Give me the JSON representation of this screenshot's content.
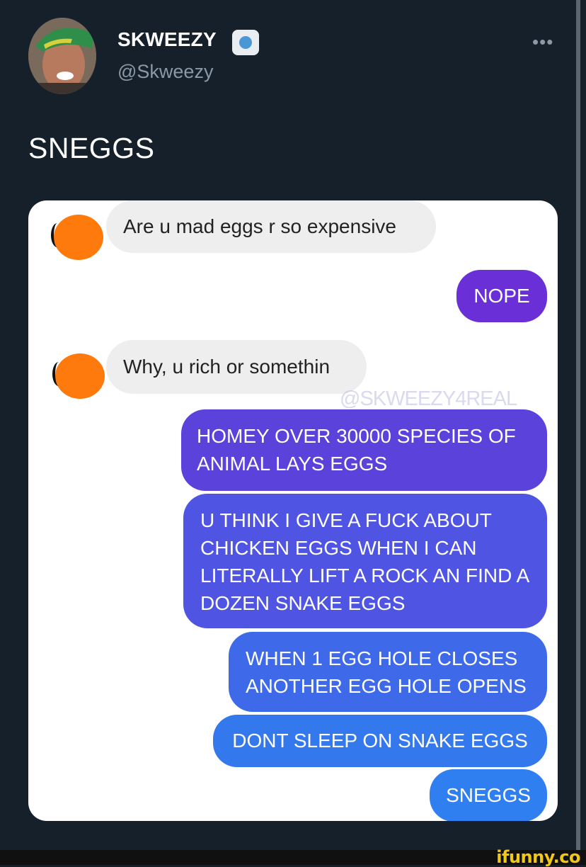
{
  "author": {
    "display_name": "SKWEEZY",
    "handle": "@Skweezy",
    "more_icon": "more-horizontal-icon"
  },
  "tweet": {
    "text": "SNEGGS"
  },
  "media": {
    "watermark": "@SKWEEZY4REAL",
    "messages": [
      {
        "from": "them",
        "text": "Are u mad eggs r so expensive"
      },
      {
        "from": "me",
        "text": "NOPE"
      },
      {
        "from": "them",
        "text": "Why, u rich or somethin"
      },
      {
        "from": "me",
        "text": "HOMEY OVER 30000 SPECIES OF ANIMAL LAYS EGGS"
      },
      {
        "from": "me",
        "text": "U THINK I GIVE A FUCK ABOUT CHICKEN EGGS WHEN I CAN LITERALLY LIFT A ROCK AN FIND A DOZEN SNAKE EGGS"
      },
      {
        "from": "me",
        "text": "WHEN 1 EGG HOLE CLOSES ANOTHER EGG HOLE OPENS"
      },
      {
        "from": "me",
        "text": "DONT SLEEP ON SNAKE EGGS"
      },
      {
        "from": "me",
        "text": "SNEGGS"
      }
    ]
  },
  "footer": {
    "logo": "ifunny.co"
  },
  "colors": {
    "background": "#15202b",
    "incoming_bubble": "#eeeeee",
    "outgoing_purple": "#6a2fd6",
    "outgoing_blue": "#2f7ff0",
    "avatar_placeholder": "#ff7a0c",
    "ifunny_yellow": "#f2c816"
  }
}
